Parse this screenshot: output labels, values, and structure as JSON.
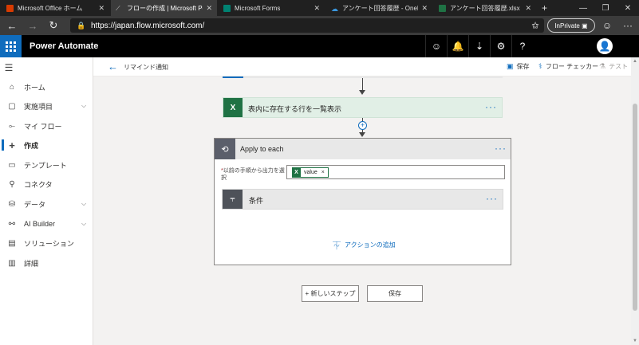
{
  "browser": {
    "tabs": [
      {
        "title": "Microsoft Office ホーム",
        "icon": "office-icon",
        "active": false,
        "color": "#d83b01"
      },
      {
        "title": "フローの作成 | Microsoft Power Automate",
        "icon": "power-automate-icon",
        "active": true,
        "color": "#8a8a8a"
      },
      {
        "title": "Microsoft Forms",
        "icon": "forms-icon",
        "active": false,
        "color": "#008272"
      },
      {
        "title": "アンケート回答履歴 - OneDrive",
        "icon": "onedrive-icon",
        "active": false,
        "color": "#0f6cbd"
      },
      {
        "title": "アンケート回答履歴.xlsx",
        "icon": "excel-icon",
        "active": false,
        "color": "#1f7244"
      }
    ],
    "new_tab_label": "+",
    "url": "https://japan.flow.microsoft.com/",
    "inprivate_label": "InPrivate"
  },
  "app": {
    "title": "Power Automate",
    "header_icons": [
      "smiley-icon",
      "bell-icon",
      "download-icon",
      "gear-icon",
      "help-icon"
    ],
    "header_icon_glyphs": [
      "☺",
      "🔔",
      "⇣",
      "⚙",
      "?"
    ]
  },
  "sidebar": {
    "items": [
      {
        "label": "ホーム",
        "icon": "home-icon",
        "glyph": "⌂",
        "chevron": false,
        "selected": false
      },
      {
        "label": "実施項目",
        "icon": "clipboard-icon",
        "glyph": "▢",
        "chevron": true,
        "selected": false
      },
      {
        "label": "マイ フロー",
        "icon": "flow-icon",
        "glyph": "⟜",
        "chevron": false,
        "selected": false
      },
      {
        "label": "作成",
        "icon": "plus-icon",
        "glyph": "+",
        "chevron": false,
        "selected": true
      },
      {
        "label": "テンプレート",
        "icon": "template-icon",
        "glyph": "▭",
        "chevron": false,
        "selected": false
      },
      {
        "label": "コネクタ",
        "icon": "connector-icon",
        "glyph": "⚲",
        "chevron": false,
        "selected": false
      },
      {
        "label": "データ",
        "icon": "data-icon",
        "glyph": "⛁",
        "chevron": true,
        "selected": false
      },
      {
        "label": "AI Builder",
        "icon": "ai-builder-icon",
        "glyph": "⚯",
        "chevron": true,
        "selected": false
      },
      {
        "label": "ソリューション",
        "icon": "solution-icon",
        "glyph": "▤",
        "chevron": false,
        "selected": false
      },
      {
        "label": "詳細",
        "icon": "book-icon",
        "glyph": "▥",
        "chevron": false,
        "selected": false
      }
    ]
  },
  "command_bar": {
    "flow_name": "リマインド通知",
    "save_label": "保存",
    "checker_label": "フロー チェッカー",
    "test_label": "テスト"
  },
  "flow": {
    "list_rows": {
      "title": "表内に存在する行を一覧表示",
      "more": "···"
    },
    "apply_each": {
      "title": "Apply to each",
      "more": "···",
      "field_label": "以前の手順から出力を選択",
      "required_mark": "*",
      "token_label": "value",
      "token_remove": "×",
      "condition_title": "条件",
      "condition_more": "···",
      "add_action_label": "アクションの追加"
    }
  },
  "footer": {
    "new_step_label": "+ 新しいステップ",
    "save_label": "保存"
  }
}
